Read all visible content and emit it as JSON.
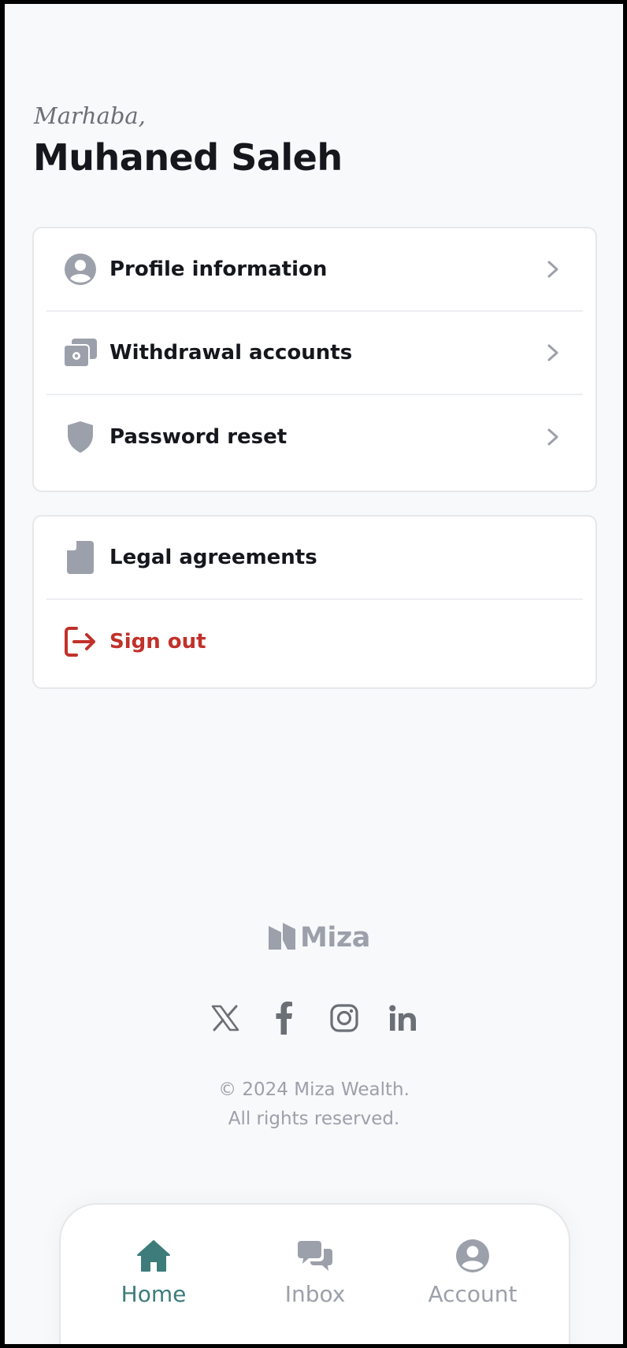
{
  "header": {
    "greeting": "Marhaba,",
    "user_name": "Muhaned Saleh"
  },
  "settings_menu": {
    "items": [
      {
        "label": "Profile information",
        "icon": "user-circle-icon"
      },
      {
        "label": "Withdrawal accounts",
        "icon": "money-stack-icon"
      },
      {
        "label": "Password reset",
        "icon": "shield-icon"
      }
    ]
  },
  "legal_menu": {
    "items": [
      {
        "label": "Legal agreements",
        "icon": "document-icon"
      },
      {
        "label": "Sign out",
        "icon": "sign-out-icon"
      }
    ]
  },
  "footer": {
    "brand": "Miza",
    "socials": [
      "x-icon",
      "facebook-icon",
      "instagram-icon",
      "linkedin-icon"
    ],
    "copyright_line1": "© 2024 Miza Wealth.",
    "copyright_line2": "All rights reserved."
  },
  "tabbar": {
    "tabs": [
      {
        "label": "Home",
        "icon": "home-icon",
        "active": true
      },
      {
        "label": "Inbox",
        "icon": "chat-bubbles-icon",
        "active": false
      },
      {
        "label": "Account",
        "icon": "user-circle-icon",
        "active": false
      }
    ]
  },
  "colors": {
    "background": "#f8f9fb",
    "icon_gray": "#9ca0aa",
    "danger": "#c1312a",
    "accent": "#3d7c7b",
    "text": "#15171c"
  }
}
